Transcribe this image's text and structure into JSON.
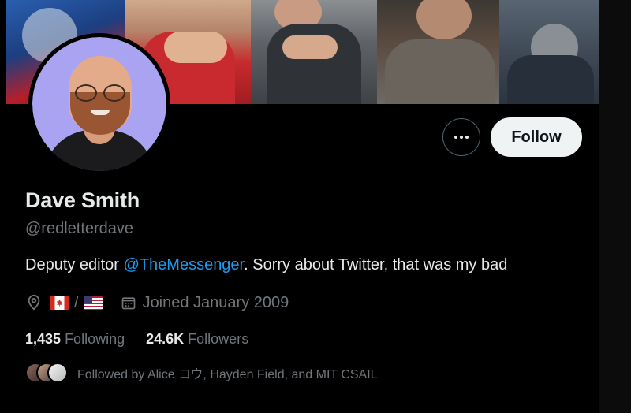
{
  "profile": {
    "name": "Dave Smith",
    "handle": "@redletterdave",
    "bio_prefix": "Deputy editor ",
    "bio_mention": "@TheMessenger",
    "bio_suffix": ". Sorry about Twitter, that was my bad",
    "location_separator": "/",
    "joined": "Joined January 2009"
  },
  "stats": {
    "following_count": "1,435",
    "following_label": "Following",
    "followers_count": "24.6K",
    "followers_label": "Followers"
  },
  "followed_by": "Followed by Alice コウ, Hayden Field, and MIT CSAIL",
  "actions": {
    "follow_label": "Follow",
    "more_icon": "more-horizontal-icon"
  },
  "colors": {
    "background": "#000000",
    "primary_text": "#e7e9ea",
    "secondary_text": "#71767b",
    "link": "#1d9bf0",
    "follow_button_bg": "#eff3f4"
  }
}
